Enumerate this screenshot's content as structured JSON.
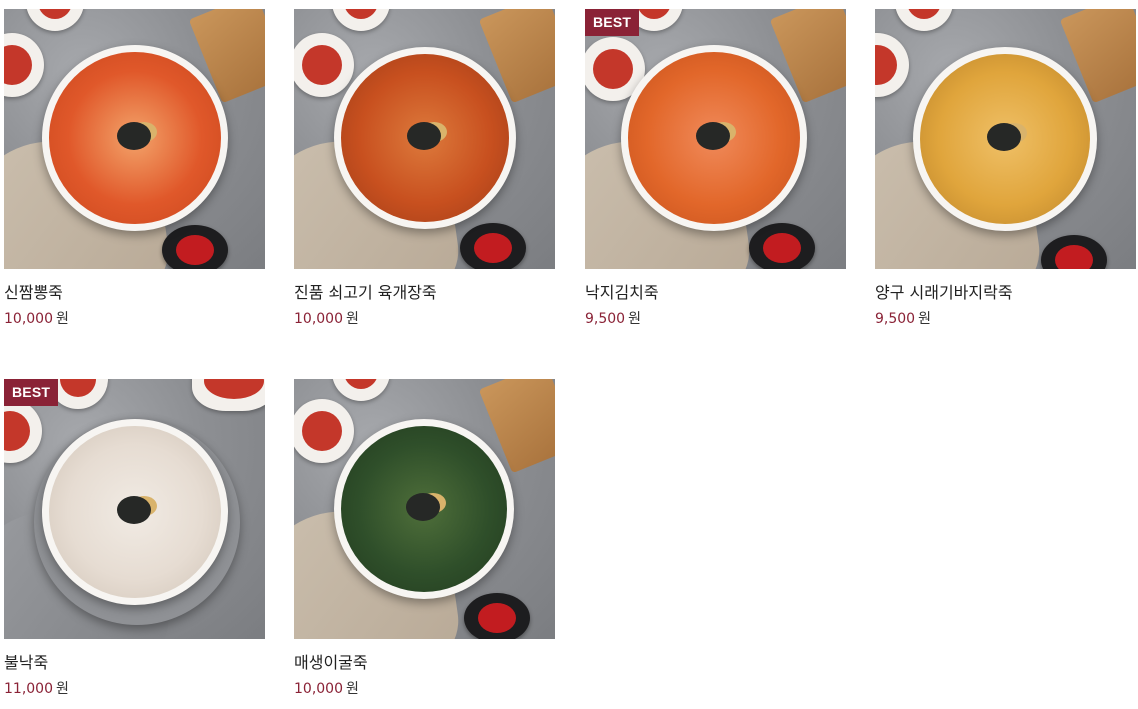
{
  "products": [
    {
      "name": "신짬뽕죽",
      "price": "10,000",
      "unit": "원",
      "badge": "",
      "porridge_color": "#e0582a",
      "topping_color": "#f0b070"
    },
    {
      "name": "진품 쇠고기 육개장죽",
      "price": "10,000",
      "unit": "원",
      "badge": "",
      "porridge_color": "#c8501f",
      "topping_color": "#6fb03a"
    },
    {
      "name": "낙지김치죽",
      "price": "9,500",
      "unit": "원",
      "badge": "BEST",
      "porridge_color": "#e2672a",
      "topping_color": "#f08a5a"
    },
    {
      "name": "양구 시래기바지락죽",
      "price": "9,500",
      "unit": "원",
      "badge": "",
      "porridge_color": "#e0a53c",
      "topping_color": "#3c5a2a"
    },
    {
      "name": "불낙죽",
      "price": "11,000",
      "unit": "원",
      "badge": "BEST",
      "porridge_color": "#e6dcd2",
      "topping_color": "#9c6b8a"
    },
    {
      "name": "매생이굴죽",
      "price": "10,000",
      "unit": "원",
      "badge": "",
      "porridge_color": "#2f4f2a",
      "topping_color": "#d9d4c4"
    }
  ],
  "colors": {
    "accent": "#8a2236",
    "badge_bg": "#8a2236"
  }
}
